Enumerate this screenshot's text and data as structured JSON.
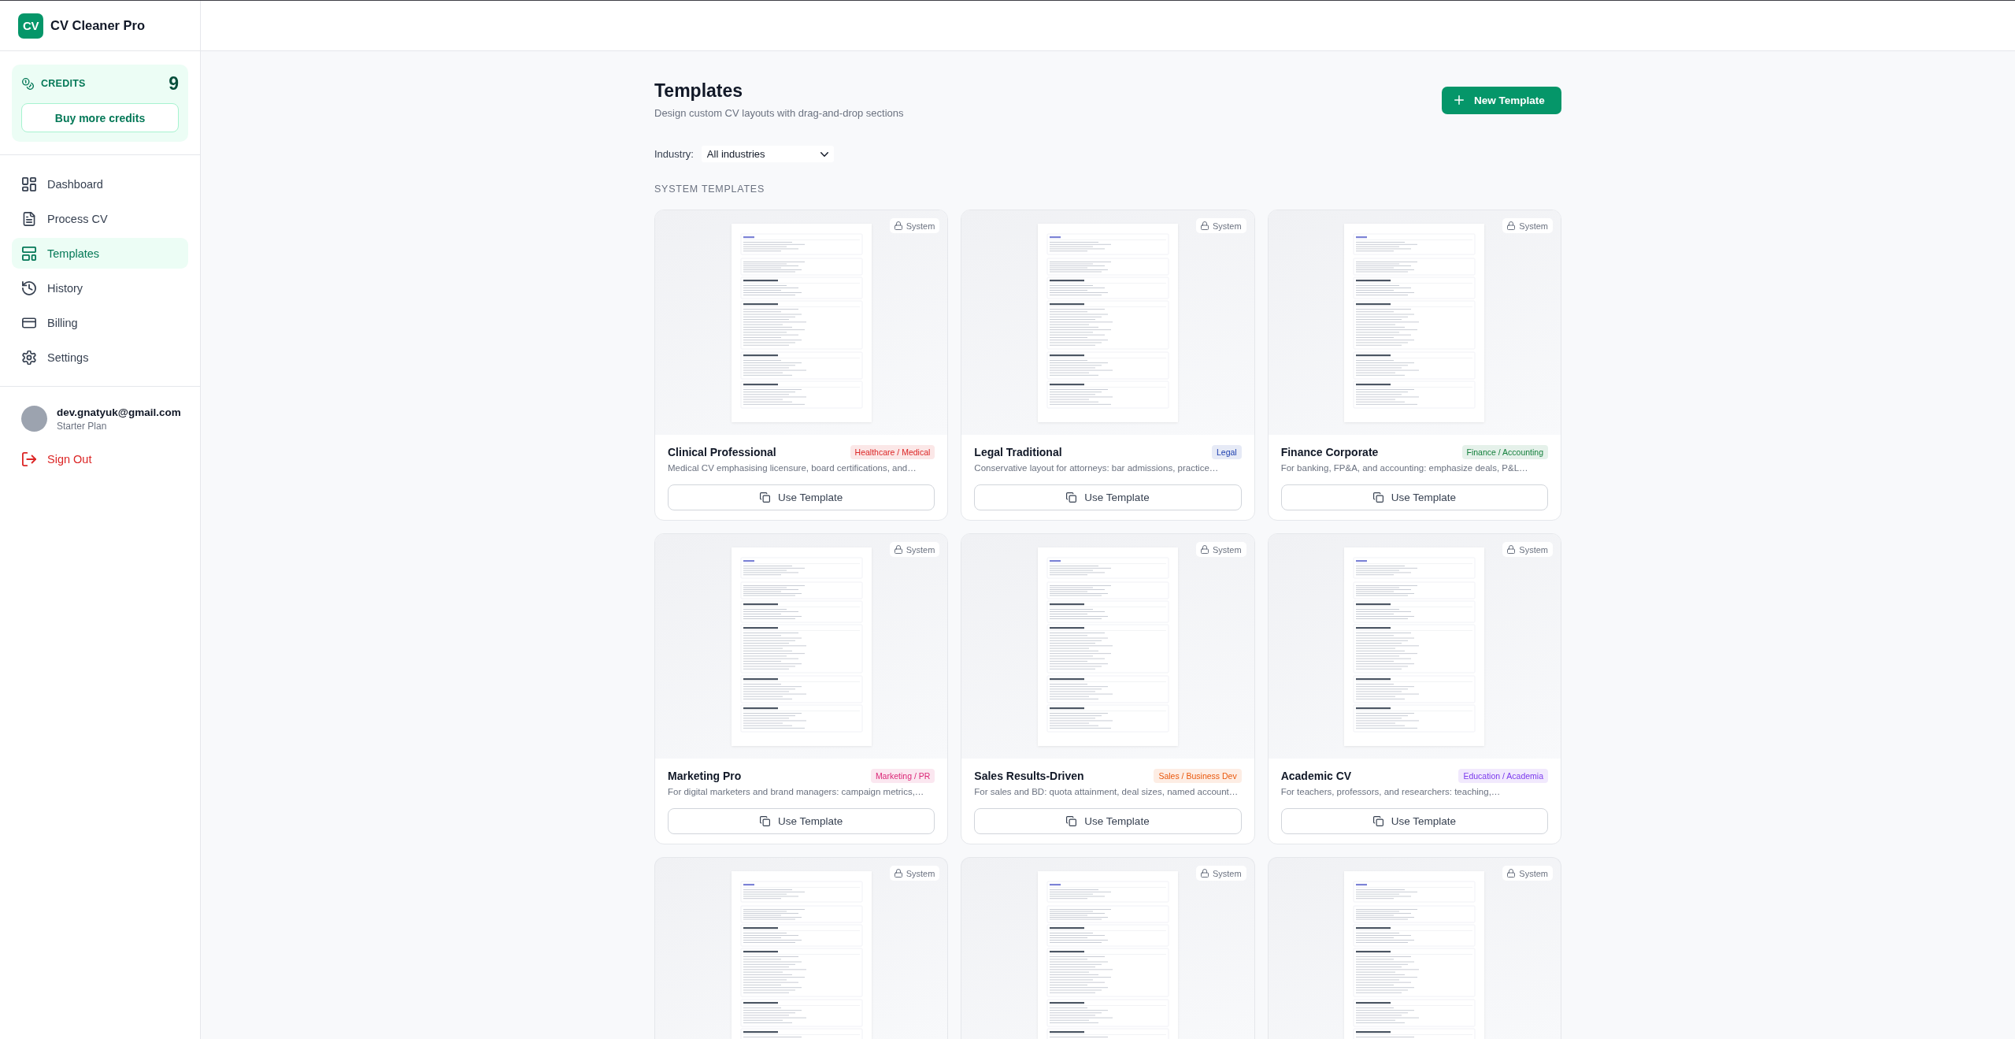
{
  "app": {
    "logo": "CV",
    "name": "CV Cleaner Pro"
  },
  "credits": {
    "label": "CREDITS",
    "count": "9",
    "button": "Buy more credits"
  },
  "sidebar": {
    "items": [
      {
        "label": "Dashboard",
        "selected": false
      },
      {
        "label": "Process CV",
        "selected": false
      },
      {
        "label": "Templates",
        "selected": true
      },
      {
        "label": "History",
        "selected": false
      },
      {
        "label": "Billing",
        "selected": false
      },
      {
        "label": "Settings",
        "selected": false
      }
    ]
  },
  "account": {
    "email": "dev.gnatyuk@gmail.com",
    "plan": "Starter Plan",
    "sign_out": "Sign Out"
  },
  "page": {
    "title": "Templates",
    "subtitle": "Design custom CV layouts with drag-and-drop sections",
    "new_button": "New Template"
  },
  "filter": {
    "label": "Industry:",
    "value": "All industries"
  },
  "section_title": "SYSTEM TEMPLATES",
  "templates": [
    {
      "badge": "System",
      "title": "Clinical Professional",
      "tag": "Healthcare / Medical",
      "color": "#dc2626",
      "description": "Medical CV emphasising licensure, board certifications, and…",
      "button": "Use Template"
    },
    {
      "badge": "System",
      "title": "Legal Traditional",
      "tag": "Legal",
      "color": "#1e40af",
      "description": "Conservative layout for attorneys: bar admissions, practice…",
      "button": "Use Template"
    },
    {
      "badge": "System",
      "title": "Finance Corporate",
      "tag": "Finance / Accounting",
      "color": "#15803d",
      "description": "For banking, FP&A, and accounting: emphasize deals, P&L…",
      "button": "Use Template"
    },
    {
      "badge": "System",
      "title": "Marketing Pro",
      "tag": "Marketing / PR",
      "color": "#db2777",
      "description": "For digital marketers and brand managers: campaign metrics,…",
      "button": "Use Template"
    },
    {
      "badge": "System",
      "title": "Sales Results-Driven",
      "tag": "Sales / Business Dev",
      "color": "#ea580c",
      "description": "For sales and BD: quota attainment, deal sizes, named account…",
      "button": "Use Template"
    },
    {
      "badge": "System",
      "title": "Academic CV",
      "tag": "Education / Academia",
      "color": "#7c3aed",
      "description": "For teachers, professors, and researchers: teaching,…",
      "button": "Use Template"
    },
    {
      "badge": "System"
    },
    {
      "badge": "System"
    },
    {
      "badge": "System"
    }
  ]
}
